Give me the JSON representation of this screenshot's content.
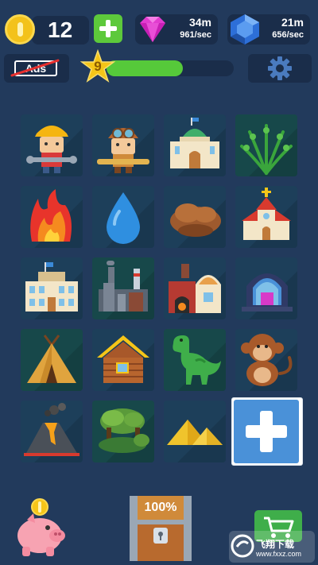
{
  "resources": {
    "coins": "12",
    "gems": {
      "amount": "34m",
      "rate": "961/sec"
    },
    "sapphires": {
      "amount": "21m",
      "rate": "656/sec"
    }
  },
  "ads": {
    "label": "Ads"
  },
  "level": {
    "number": "9",
    "progress": 0.6
  },
  "grid": {
    "tiles": [
      "worker",
      "pilot",
      "observatory",
      "fern",
      "fire",
      "water-drop",
      "mud",
      "church",
      "school",
      "factory",
      "forge",
      "observatory-machine",
      "tepee",
      "log-cabin",
      "dinosaur",
      "monkey",
      "volcano",
      "swamp",
      "sand-dunes",
      "add"
    ]
  },
  "chest": {
    "label": "100%"
  },
  "watermark": {
    "title": "飞翔下载",
    "url": "www.fxxz.com"
  },
  "colors": {
    "background": "#223a5c",
    "accent_green": "#56c93a",
    "coin": "#f3c21b",
    "plus_blue": "#4a91d8"
  }
}
